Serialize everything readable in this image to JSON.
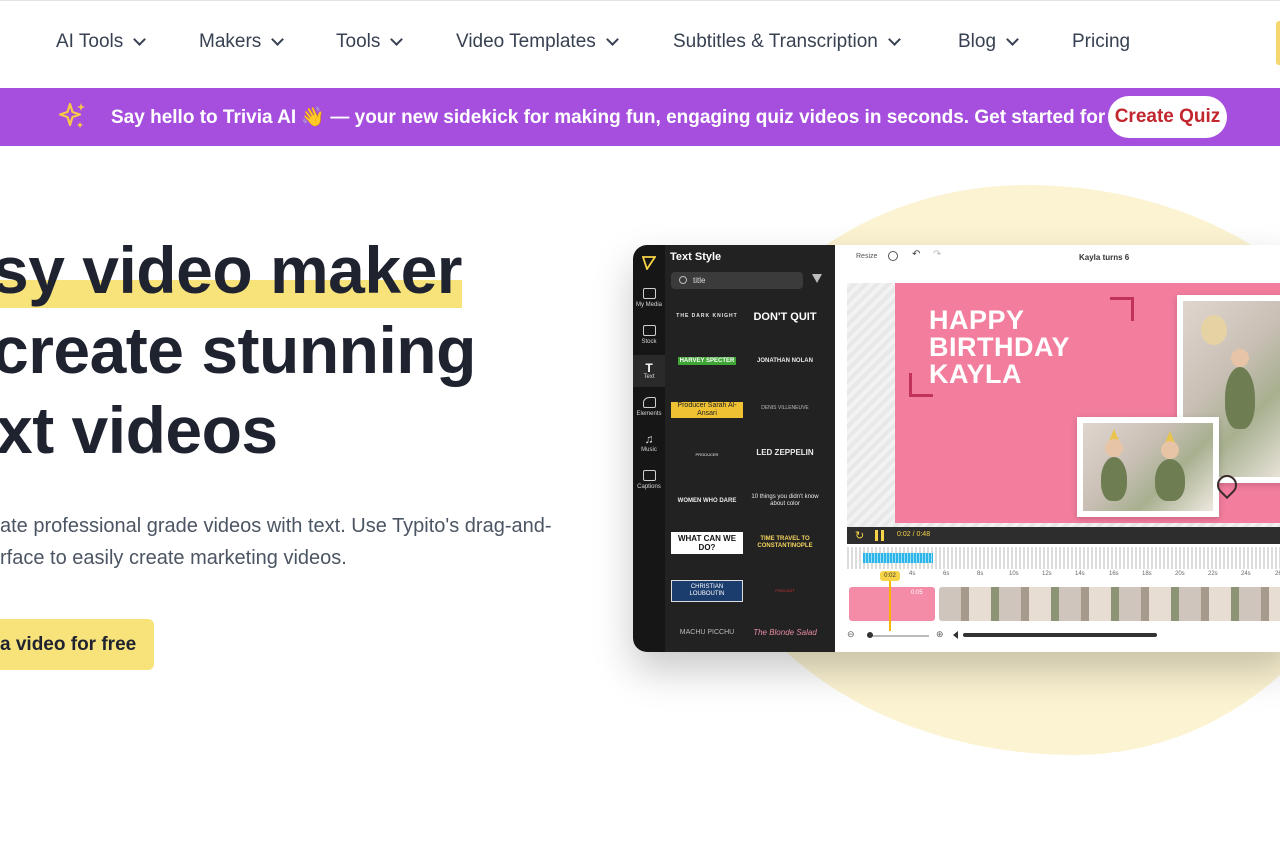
{
  "nav": {
    "items": [
      {
        "label": "AI Tools",
        "dropdown": true
      },
      {
        "label": "Makers",
        "dropdown": true
      },
      {
        "label": "Tools",
        "dropdown": true
      },
      {
        "label": "Video Templates",
        "dropdown": true
      },
      {
        "label": "Subtitles & Transcription",
        "dropdown": true
      },
      {
        "label": "Blog",
        "dropdown": true
      },
      {
        "label": "Pricing",
        "dropdown": false
      }
    ]
  },
  "banner": {
    "icon": "sparkle-icon",
    "text": "Say hello to Trivia AI 👋 — your new sidekick for making fun, engaging quiz videos in seconds. Get started for free",
    "button_label": "Create Quiz",
    "background": "#a64fde",
    "button_text_color": "#c2262e"
  },
  "hero": {
    "line1": "sy video maker",
    "line2": "create stunning",
    "line3": "xt videos",
    "description_line1": "ate professional grade videos with text. Use Typito's drag-and-",
    "description_line2": "rface to easily create marketing videos.",
    "cta_label": "a video for free",
    "accent": "#f7e37a"
  },
  "app": {
    "rail": [
      {
        "label": "My Media",
        "icon": "folder-icon"
      },
      {
        "label": "Stock",
        "icon": "film-icon"
      },
      {
        "label": "Text",
        "icon": "text-icon"
      },
      {
        "label": "Elements",
        "icon": "shapes-icon"
      },
      {
        "label": "Music",
        "icon": "music-icon"
      },
      {
        "label": "Captions",
        "icon": "captions-icon"
      }
    ],
    "panel": {
      "title": "Text Style",
      "search_value": "title",
      "tiles": [
        "THE DARK KNIGHT",
        "DON'T QUIT",
        "HARVEY SPECTER",
        "JONATHAN NOLAN",
        "Producer Sarah Al-Ansari",
        "DENIS VILLENEUVE",
        "PRODUCER",
        "LED ZEPPELIN",
        "WOMEN WHO DARE",
        "10 things you didn't know about color",
        "WHAT CAN WE DO?",
        "TIME TRAVEL TO CONSTANTINOPLE",
        "CHRISTIAN LOUBOUTIN",
        "PODCAST",
        "MACHU PICCHU",
        "The Blonde Salad"
      ]
    },
    "editor": {
      "resize_label": "Resize",
      "project_title": "Kayla turns 6",
      "canvas_text": "HAPPY BIRTHDAY KAYLA",
      "time_display": "0:02 / 0:48",
      "playhead_label": "0:02",
      "clip_label": "0:05",
      "ruler": [
        "4s",
        "6s",
        "8s",
        "10s",
        "12s",
        "14s",
        "16s",
        "18s",
        "20s",
        "22s",
        "24s",
        "26"
      ]
    }
  }
}
